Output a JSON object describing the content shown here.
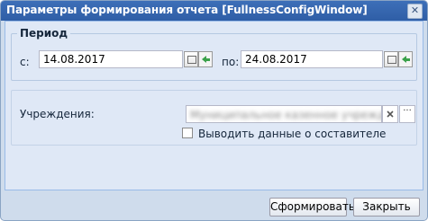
{
  "window": {
    "title": "Параметры формирования отчета [FullnessConfigWindow]"
  },
  "period": {
    "legend": "Период",
    "from_label": "с:",
    "from_value": "14.08.2017",
    "to_label": "по:",
    "to_value": "24.08.2017"
  },
  "institution": {
    "label": "Учреждения:",
    "value": "Муниципальное казенное учреждение",
    "show_compiler_label": "Выводить данные о составителе"
  },
  "buttons": {
    "generate": "Сформировать",
    "close": "Закрыть"
  },
  "icons": {
    "close": "close-icon",
    "calendar": "calendar-icon",
    "back": "back-arrow-icon",
    "clear": "clear-icon",
    "more": "ellipsis-icon"
  }
}
